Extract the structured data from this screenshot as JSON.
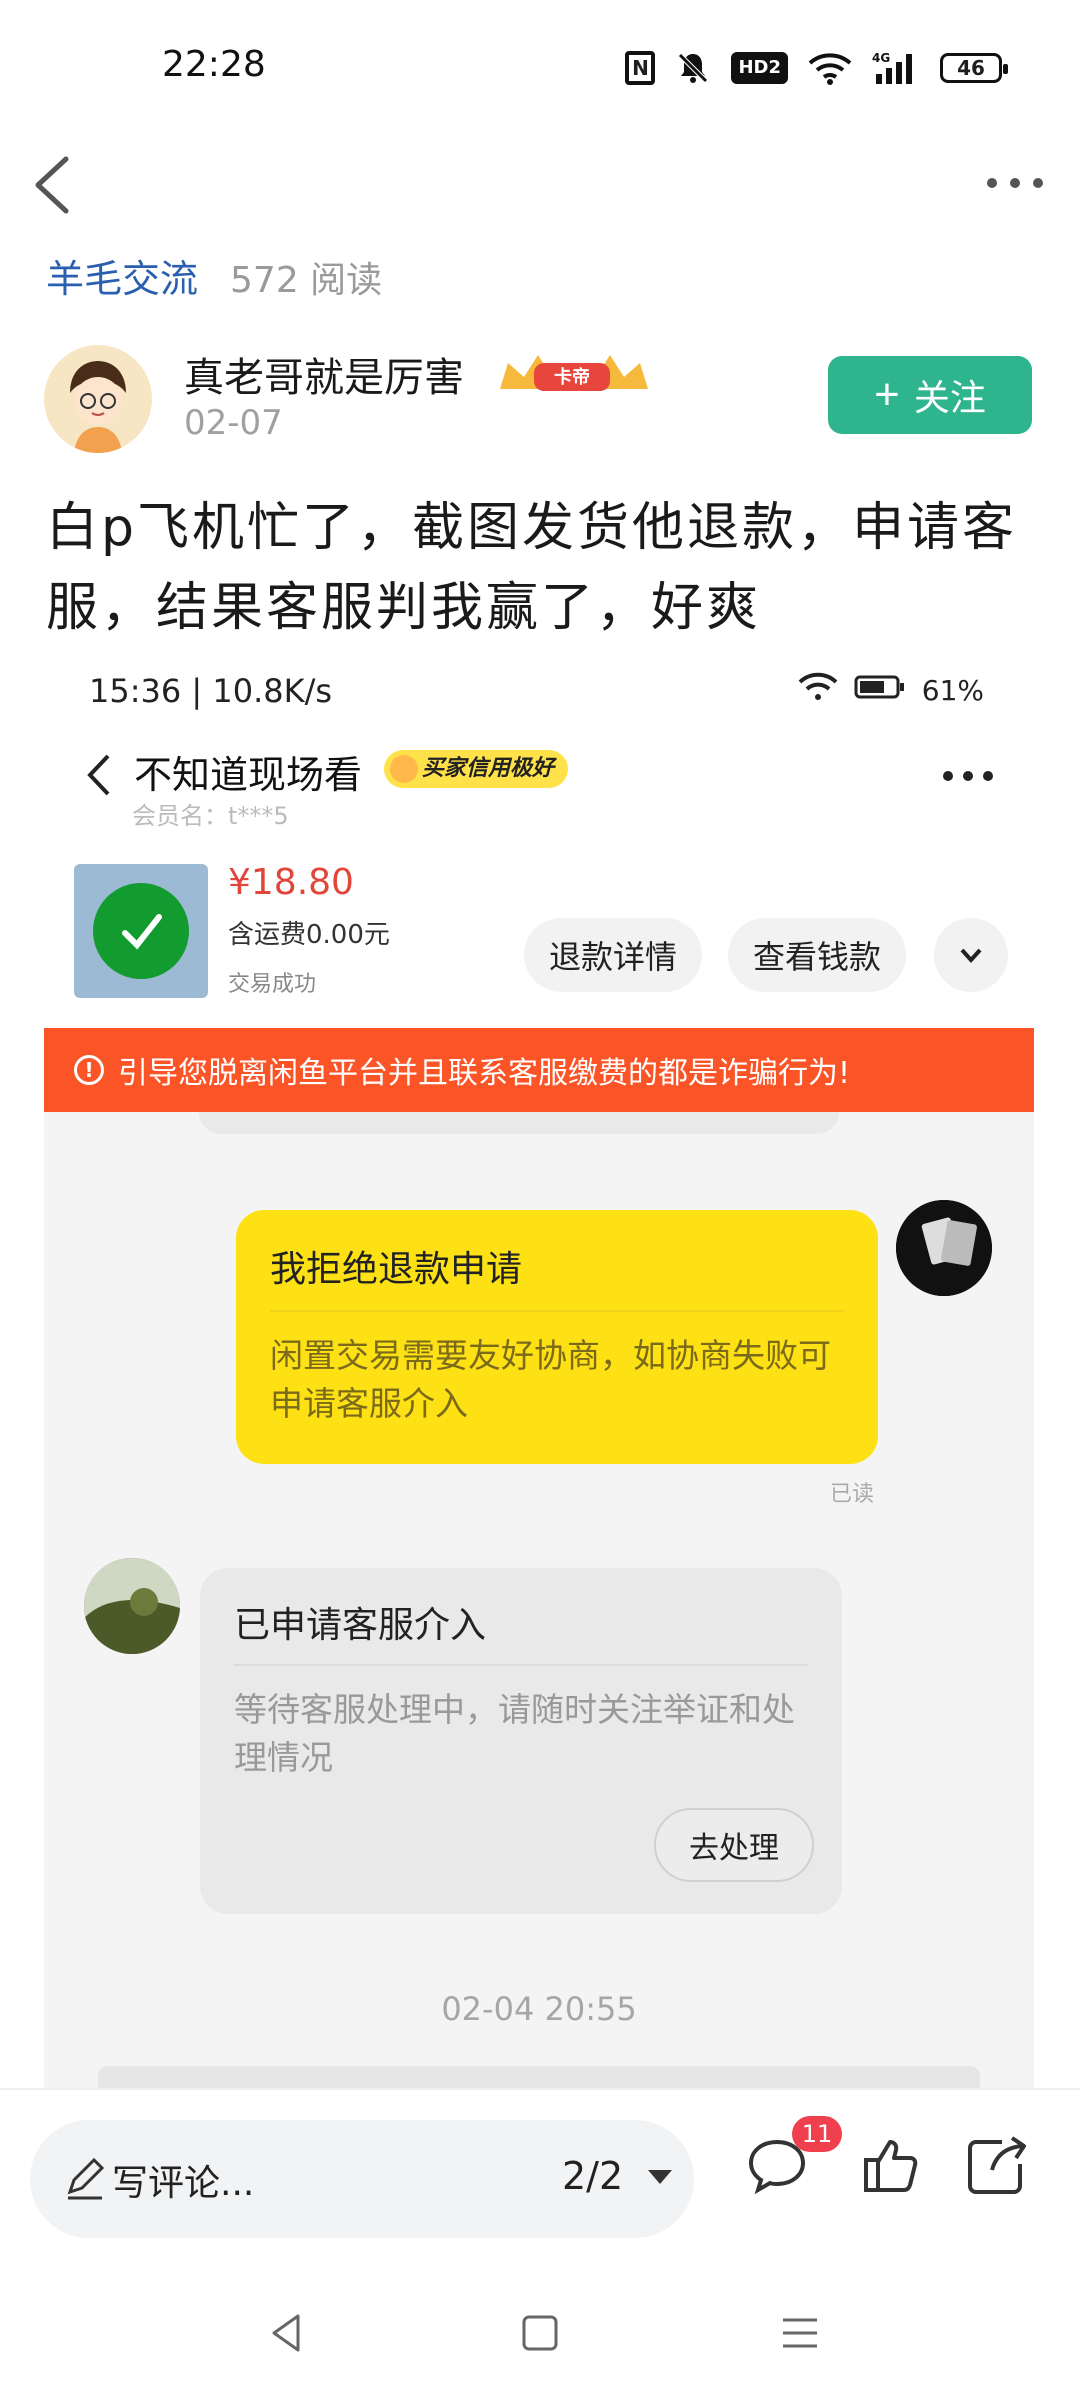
{
  "status_bar": {
    "time": "22:28",
    "nfc": "N",
    "hd": "HD2",
    "signal_label": "4G",
    "battery": "46",
    "icons": [
      "nfc-icon",
      "mute-bell-icon",
      "hd-icon",
      "wifi-icon",
      "signal-icon",
      "battery-icon"
    ]
  },
  "nav": {
    "back_icon": "back-icon",
    "more_icon": "more-icon"
  },
  "meta": {
    "category": "羊毛交流",
    "reads": "572 阅读"
  },
  "author": {
    "name": "真老哥就是厉害",
    "badge_text": "卡帝",
    "date": "02-07",
    "follow_label": "关注"
  },
  "post": {
    "title": "白p飞机忙了，截图发货他退款，申请客服，结果客服判我赢了，好爽"
  },
  "screenshot": {
    "status_left": "15:36 | 10.8K/s",
    "status_battery": "61%",
    "chat_name": "不知道现场看",
    "credit_badge": "买家信用极好",
    "member": "会员名：t***5",
    "price": "¥18.80",
    "shipping": "含运费0.00元",
    "trade_status": "交易成功",
    "btn_refund_detail": "退款详情",
    "btn_view_money": "查看钱款",
    "warning": "引导您脱离闲鱼平台并且联系客服缴费的都是诈骗行为!",
    "bubble1_title": "我拒绝退款申请",
    "bubble1_text": "闲置交易需要友好协商，如协商失败可申请客服介入",
    "read_label": "已读",
    "bubble2_title": "已申请客服介入",
    "bubble2_text": "等待客服处理中，请随时关注举证和处理情况",
    "handle_button": "去处理",
    "timestamp": "02-04 20:55"
  },
  "bottom": {
    "comment_placeholder": "写评论...",
    "page_indicator": "2/2",
    "comment_count": "11"
  },
  "colors": {
    "accent_green": "#2fb58d",
    "link_blue": "#2a5fb0",
    "warning_orange": "#fa5427",
    "bubble_yellow": "#fde115",
    "badge_red": "#f0404e"
  }
}
